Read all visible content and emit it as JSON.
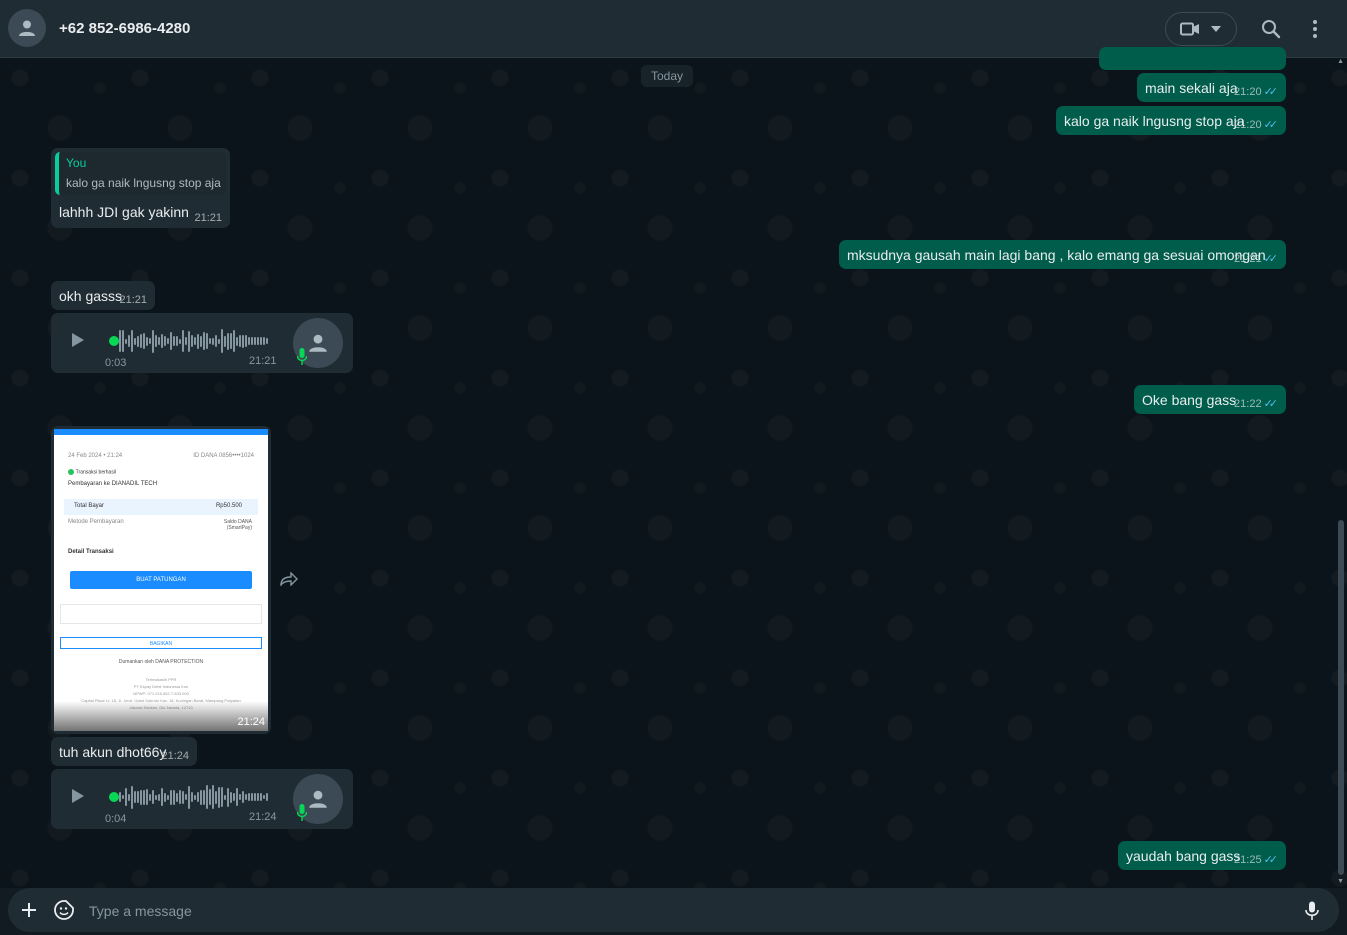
{
  "header": {
    "contact_name": "+62 852-6986-4280",
    "avatar_icon": "default-avatar-icon",
    "video_icon": "video-camera-icon",
    "search_icon": "search-icon",
    "menu_icon": "kebab-menu-icon"
  },
  "chat": {
    "date_label": "Today",
    "messages": [
      {
        "dir": "out",
        "text": "main sekali aja",
        "time": "21:20",
        "status": "read"
      },
      {
        "dir": "out",
        "text": "kalo ga naik lngusng stop aja",
        "time": "21:20",
        "status": "read"
      },
      {
        "dir": "in",
        "quote_author": "You",
        "quote_text": "kalo ga naik lngusng stop aja",
        "text": "lahhh JDI gak yakinn",
        "time": "21:21"
      },
      {
        "dir": "out",
        "text": "mksudnya gausah main lagi bang , kalo emang ga sesuai omongan",
        "time": "21:21",
        "status": "read"
      },
      {
        "dir": "in",
        "text": "okh gasss",
        "time": "21:21"
      },
      {
        "dir": "in",
        "type": "voice",
        "duration": "0:03",
        "time": "21:21"
      },
      {
        "dir": "out",
        "text": "Oke  bang gass",
        "time": "21:22",
        "status": "read"
      },
      {
        "dir": "in",
        "type": "image",
        "time": "21:24"
      },
      {
        "dir": "in",
        "text": "tuh akun dhot66y",
        "time": "21:24"
      },
      {
        "dir": "in",
        "type": "voice",
        "duration": "0:04",
        "time": "21:24"
      },
      {
        "dir": "out",
        "text": "yaudah bang gass",
        "time": "21:25",
        "status": "read"
      }
    ]
  },
  "receipt": {
    "date": "24 Feb 2024 • 21:24",
    "id_text": "ID DANA 0856••••1024",
    "status": "Transaksi berhasil",
    "payee": "Pembayaran ke DIANADIL TECH",
    "total_label": "Total Bayar",
    "total_value": "Rp50.500",
    "method_label": "Metode Pembayaran",
    "method_value": "Saldo DANA (SmartPay)",
    "detail_label": "Detail Transaksi",
    "button_primary": "BUAT PATUNGAN",
    "button_share": "BAGIKAN",
    "protection": "Dumankan oleh DANA PROTECTION",
    "footer_1": "Terimakasih PPR",
    "footer_2": "PT Espay Debit Indonesia Koe",
    "footer_3": "NPWP: 071.216.552.7-633.000",
    "footer_4": "Capital Place Lt. 18, Jl. Jend. Gatot Subroto Kav. 18, Kuningan Barat, Mampang Prapatan",
    "footer_5": "Jakarta Selatan, Dki Jakarta, 12710"
  },
  "composer": {
    "placeholder": "Type a message",
    "plus_icon": "plus-icon",
    "emoji_icon": "emoji-sticker-icon",
    "mic_icon": "microphone-icon"
  },
  "colors": {
    "outgoing_bubble": "#005c4b",
    "incoming_bubble": "#202c33",
    "read_tick": "#53bdeb",
    "quote_accent": "#06cf9c",
    "voice_dot": "#06d755",
    "receipt_brand": "#1a8cff"
  }
}
